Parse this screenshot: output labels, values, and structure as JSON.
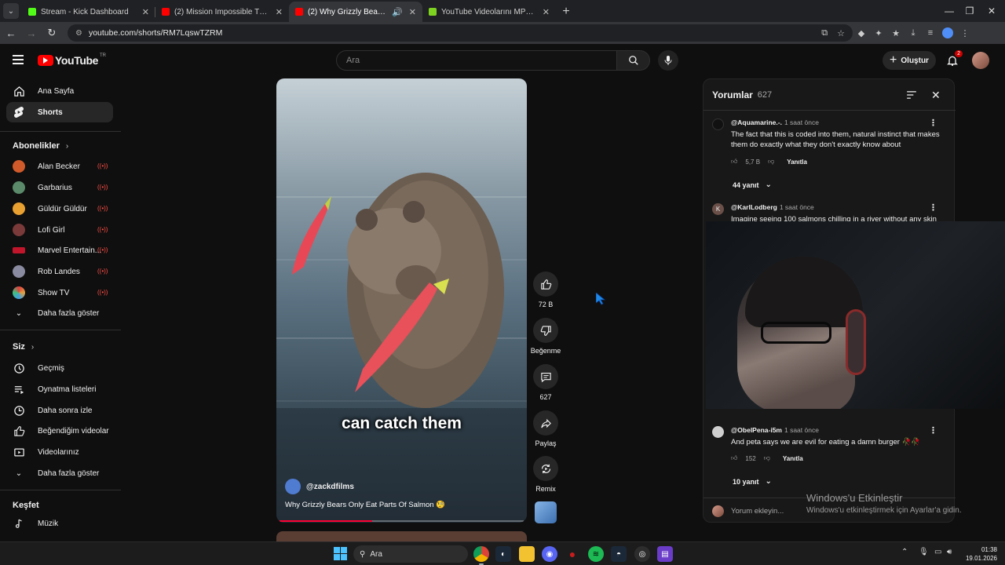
{
  "browser": {
    "tabs": [
      {
        "title": "Stream - Kick Dashboard",
        "color": "#53fc18",
        "active": false
      },
      {
        "title": "(2) Mission Impossible Theme (",
        "color": "#ff0000",
        "active": false
      },
      {
        "title": "(2) Why Grizzly Bears Only E",
        "color": "#ff0000",
        "active": true
      },
      {
        "title": "YouTube Videolarını MP4 Dosy",
        "color": "#7ed321",
        "active": false
      }
    ],
    "url": "youtube.com/shorts/RM7LqswTZRM"
  },
  "header": {
    "logo_text": "YouTube",
    "country_code": "TR",
    "search_placeholder": "Ara",
    "create_label": "Oluştur",
    "notification_count": "2"
  },
  "sidebar": {
    "main": [
      {
        "label": "Ana Sayfa",
        "icon": "home-icon"
      },
      {
        "label": "Shorts",
        "icon": "shorts-icon",
        "active": true
      }
    ],
    "subscriptions_title": "Abonelikler",
    "subscriptions": [
      {
        "label": "Alan Becker",
        "color": "#d05a2a"
      },
      {
        "label": "Garbarius",
        "color": "#5a8a6a"
      },
      {
        "label": "Güldür Güldür",
        "color": "#e8a030"
      },
      {
        "label": "Lofi Girl",
        "color": "#7a3a3a"
      },
      {
        "label": "Marvel Entertain...",
        "color": "#c0152b"
      },
      {
        "label": "Rob Landes",
        "color": "#8a8aa0"
      },
      {
        "label": "Show TV",
        "color": "#e0a040"
      }
    ],
    "show_more": "Daha fazla göster",
    "you_title": "Siz",
    "you_items": [
      {
        "label": "Geçmiş",
        "icon": "history-icon"
      },
      {
        "label": "Oynatma listeleri",
        "icon": "playlist-icon"
      },
      {
        "label": "Daha sonra izle",
        "icon": "watch-later-icon"
      },
      {
        "label": "Beğendiğim videolar",
        "icon": "liked-icon"
      },
      {
        "label": "Videolarınız",
        "icon": "your-videos-icon"
      }
    ],
    "show_more_2": "Daha fazla göster",
    "explore_title": "Keşfet",
    "explore_items": [
      {
        "label": "Müzik",
        "icon": "music-icon"
      }
    ]
  },
  "video": {
    "caption": "can catch them",
    "channel": "@zackdfilms",
    "title": "Why Grizzly Bears Only Eat Parts Of Salmon 🧐",
    "progress": 0.38
  },
  "actions": {
    "likes": "72 B",
    "dislike_label": "Beğenme",
    "comments": "627",
    "share_label": "Paylaş",
    "remix_label": "Remix"
  },
  "comments": {
    "title": "Yorumlar",
    "count": "627",
    "items": [
      {
        "author": "@Aquamarine.-.",
        "time": "1 saat önce",
        "text": "The fact that this is coded into them, natural instinct that makes them do exactly what they don't exactly know about",
        "likes": "5,7 B",
        "reply": "Yanıtla",
        "replies": "44 yanıt",
        "avatar": "#111111",
        "initial": ""
      },
      {
        "author": "@KarlLodberg",
        "time": "1 saat önce",
        "text": "Imagine seeing 100 salmons chilling in a river without any skin",
        "likes": "",
        "reply": "",
        "replies": "",
        "avatar": "#6a5048",
        "initial": "K"
      },
      {
        "author": "@ObelPena-i5m",
        "time": "1 saat önce",
        "text": "And peta says we are evil for eating a damn burger 🥀🥀",
        "likes": "152",
        "reply": "Yanıtla",
        "replies": "10 yanıt",
        "avatar": "#cfcfcf",
        "initial": ""
      }
    ],
    "add_placeholder": "Yorum ekleyin..."
  },
  "activation": {
    "line1": "Windows'u Etkinleştir",
    "line2": "Windows'u etkinleştirmek için Ayarlar'a gidin."
  },
  "taskbar": {
    "search_label": "Ara",
    "time": "01:38",
    "date": "19.01.2026"
  }
}
